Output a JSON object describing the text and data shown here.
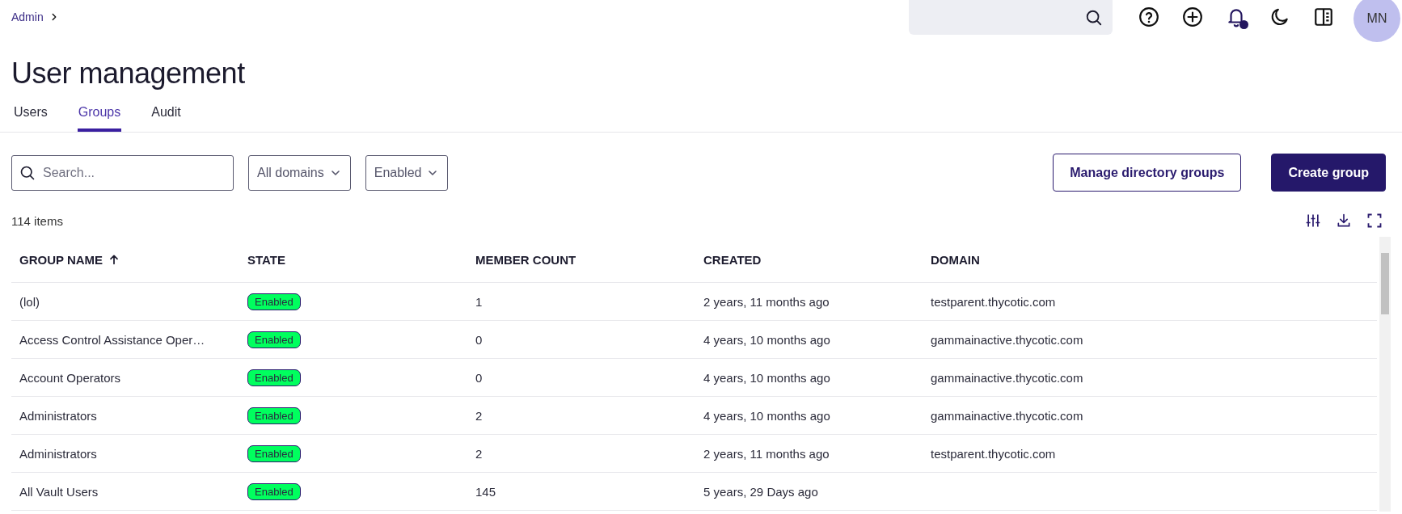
{
  "breadcrumb": {
    "label": "Admin"
  },
  "header": {
    "notifications": {
      "unread": true
    },
    "avatar": {
      "initials": "MN"
    }
  },
  "page_title": "User management",
  "tabs": [
    {
      "label": "Users",
      "selected": false
    },
    {
      "label": "Groups",
      "selected": true
    },
    {
      "label": "Audit",
      "selected": false
    }
  ],
  "filters": {
    "search": {
      "placeholder": "Search..."
    },
    "dropdowns": [
      {
        "value": "All domains"
      },
      {
        "value": "Enabled"
      }
    ]
  },
  "actions": [
    {
      "label": "Manage directory groups",
      "kind": "secondary"
    },
    {
      "label": "Create group",
      "kind": "primary"
    }
  ],
  "item_count": "114 items",
  "table": {
    "columns": [
      {
        "label": "GROUP NAME",
        "sorted": true
      },
      {
        "label": "STATE",
        "sorted": false
      },
      {
        "label": "MEMBER COUNT",
        "sorted": false
      },
      {
        "label": "CREATED",
        "sorted": false
      },
      {
        "label": "DOMAIN",
        "sorted": false
      }
    ],
    "rows": [
      {
        "group_name": "(lol)",
        "state": "Enabled",
        "member_count": "1",
        "created": "2 years, 11 months ago",
        "domain": "testparent.thycotic.com"
      },
      {
        "group_name": "Access Control Assistance Oper…",
        "state": "Enabled",
        "member_count": "0",
        "created": "4 years, 10 months ago",
        "domain": "gammainactive.thycotic.com"
      },
      {
        "group_name": "Account Operators",
        "state": "Enabled",
        "member_count": "0",
        "created": "4 years, 10 months ago",
        "domain": "gammainactive.thycotic.com"
      },
      {
        "group_name": "Administrators",
        "state": "Enabled",
        "member_count": "2",
        "created": "4 years, 10 months ago",
        "domain": "gammainactive.thycotic.com"
      },
      {
        "group_name": "Administrators",
        "state": "Enabled",
        "member_count": "2",
        "created": "2 years, 11 months ago",
        "domain": "testparent.thycotic.com"
      },
      {
        "group_name": "All Vault Users",
        "state": "Enabled",
        "member_count": "145",
        "created": "5 years, 29 Days ago"
      }
    ]
  }
}
